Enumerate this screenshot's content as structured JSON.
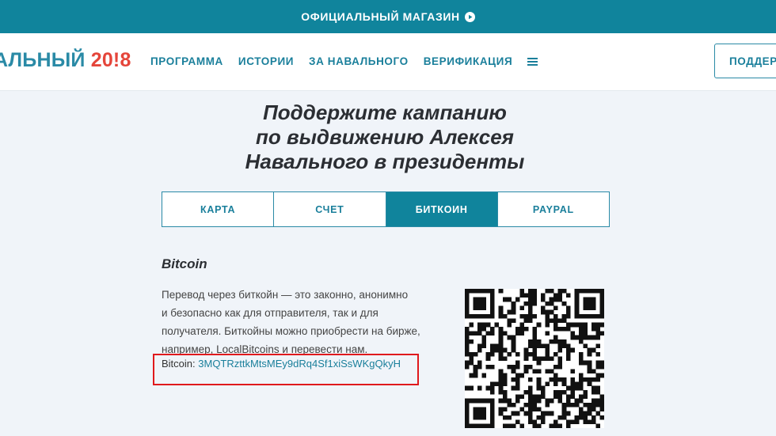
{
  "topbar": {
    "shop_label": "ОФИЦИАЛЬНЫЙ МАГАЗИН",
    "icon": "play-circle-icon"
  },
  "header": {
    "logo": {
      "name": "АЛЬНЫЙ ",
      "year": "20!8"
    },
    "nav": [
      "ПРОГРАММА",
      "ИСТОРИИ",
      "ЗА НАВАЛЬНОГО",
      "ВЕРИФИКАЦИЯ"
    ],
    "menu_icon": "hamburger-icon",
    "support_label": "ПОДДЕР"
  },
  "headline": {
    "line1": "Поддержите кампанию",
    "line2": "по выдвижению Алексея",
    "line3": "Навального в президенты"
  },
  "tabs": [
    {
      "label": "КАРТА",
      "active": false
    },
    {
      "label": "СЧЕТ",
      "active": false
    },
    {
      "label": "БИТКОИН",
      "active": true
    },
    {
      "label": "PAYPAL",
      "active": false
    }
  ],
  "bitcoin": {
    "title": "Bitcoin",
    "description_lines": [
      "Перевод через биткойн — это законно, анонимно",
      "и безопасно как для отправителя, так и для",
      "получателя. Биткойны можно приобрести на бирже,",
      "например, LocalBitcoins и перевести нам."
    ],
    "address_label": "Bitcoin:",
    "address": "3MQTRzttkMtsMEy9dRq4Sf1xiSsWKgQkyH"
  },
  "colors": {
    "topbar": "#10849c",
    "accent": "#1a7f9b",
    "logo_red": "#e5453a",
    "highlight_red": "#e0191c",
    "background": "#f0f4f9"
  }
}
